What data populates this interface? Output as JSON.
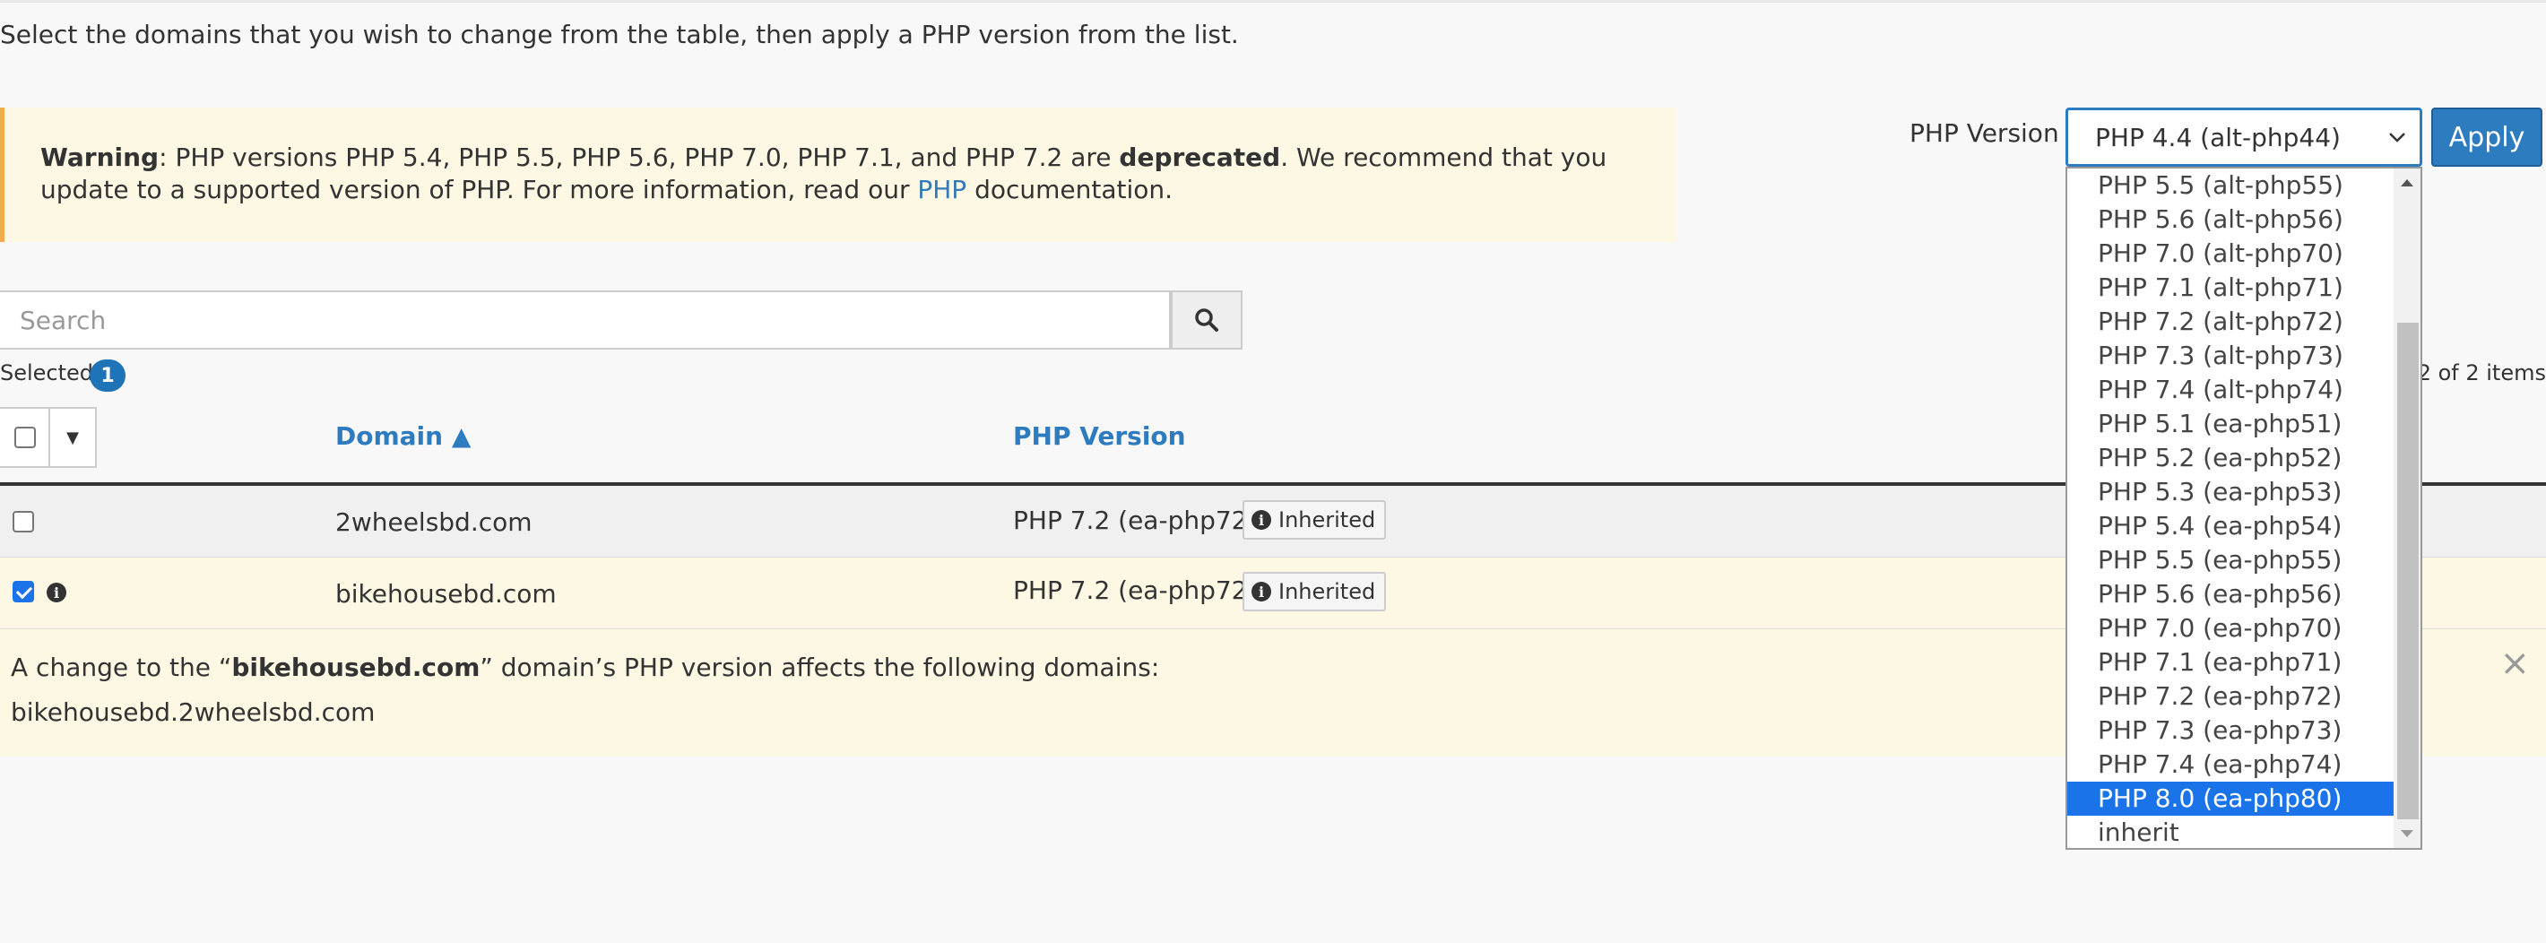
{
  "intro": "Select the domains that you wish to change from the table, then apply a PHP version from the list.",
  "warning": {
    "label": "Warning",
    "text_before": ": PHP versions PHP 5.4, PHP 5.5, PHP 5.6, PHP 7.0, PHP 7.1, and PHP 7.2 are ",
    "bold": "deprecated",
    "text_after": ". We recommend that you update to a supported version of PHP. For more information, read our ",
    "link": "PHP",
    "text_end": " documentation."
  },
  "search": {
    "placeholder": "Search"
  },
  "selection": {
    "label": "Selected",
    "count": "1"
  },
  "pager": "2 of 2 items",
  "table": {
    "headers": {
      "domain": "Domain ▲",
      "php_version": "PHP Version"
    },
    "rows": [
      {
        "domain": "2wheelsbd.com",
        "php": "PHP 7.2 (ea-php72)",
        "badge": "Inherited",
        "checked": false
      },
      {
        "domain": "bikehousebd.com",
        "php": "PHP 7.2 (ea-php72)",
        "badge": "Inherited",
        "checked": true
      }
    ]
  },
  "affected": {
    "prefix": "A change to the “",
    "domain": "bikehousebd.com",
    "suffix": "” domain’s PHP version affects the following domains:",
    "list": "bikehousebd.2wheelsbd.com",
    "close": "×"
  },
  "php_select": {
    "label": "PHP Version",
    "value": "PHP 4.4 (alt-php44)",
    "apply": "Apply",
    "options": [
      "PHP 5.5 (alt-php55)",
      "PHP 5.6 (alt-php56)",
      "PHP 7.0 (alt-php70)",
      "PHP 7.1 (alt-php71)",
      "PHP 7.2 (alt-php72)",
      "PHP 7.3 (alt-php73)",
      "PHP 7.4 (alt-php74)",
      "PHP 5.1 (ea-php51)",
      "PHP 5.2 (ea-php52)",
      "PHP 5.3 (ea-php53)",
      "PHP 5.4 (ea-php54)",
      "PHP 5.5 (ea-php55)",
      "PHP 5.6 (ea-php56)",
      "PHP 7.0 (ea-php70)",
      "PHP 7.1 (ea-php71)",
      "PHP 7.2 (ea-php72)",
      "PHP 7.3 (ea-php73)",
      "PHP 7.4 (ea-php74)",
      "PHP 8.0 (ea-php80)",
      "inherit"
    ],
    "highlighted": "PHP 8.0 (ea-php80)"
  },
  "colors": {
    "accent": "#2e7cc0",
    "warning_bg": "#fcf8e3",
    "highlight": "#1a73e8"
  }
}
